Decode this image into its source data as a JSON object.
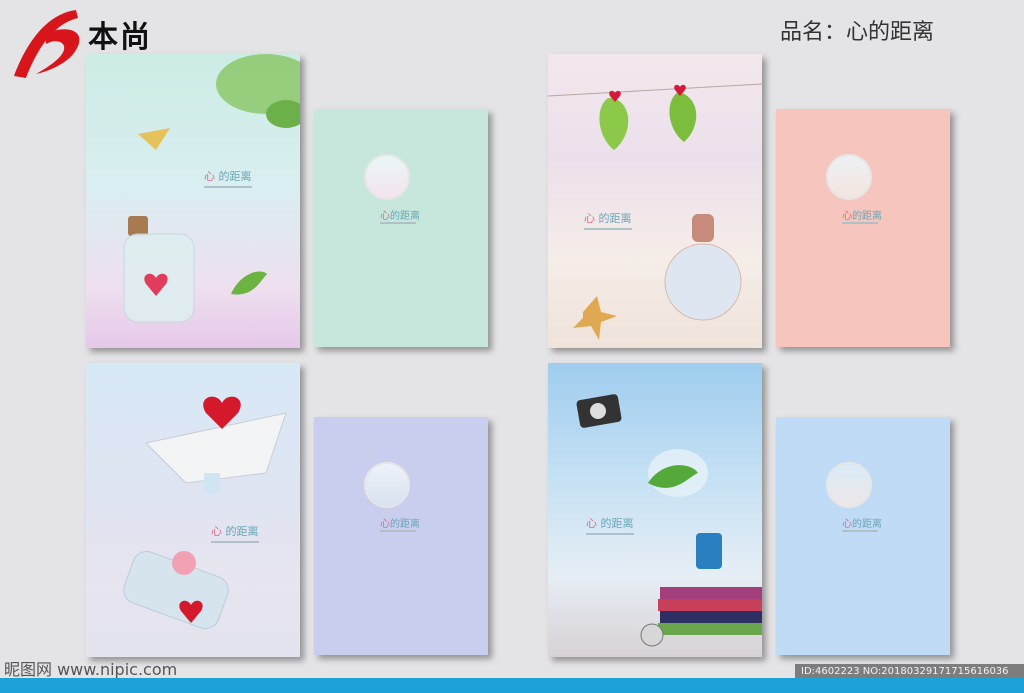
{
  "header": {
    "brand": "本尚",
    "product_label": "品名：心的距离"
  },
  "covers": [
    {
      "title_a": "心",
      "title_b": "的距离"
    },
    {
      "title_a": "心",
      "title_b": "的距离"
    },
    {
      "title_a": "心",
      "title_b": "的距离"
    },
    {
      "title_a": "心",
      "title_b": "的距离"
    }
  ],
  "backs": [
    {
      "title_a": "心",
      "title_b": "的距离",
      "color": "#c7e7dc"
    },
    {
      "title_a": "心",
      "title_b": "的距离",
      "color": "#f6c5bd"
    },
    {
      "title_a": "心",
      "title_b": "的距离",
      "color": "#c9cdee"
    },
    {
      "title_a": "心",
      "title_b": "的距离",
      "color": "#c0dbf5"
    }
  ],
  "watermark": {
    "site": "昵图网 www.nipic.com",
    "id": "ID:4602223 NO:20180329171715616036"
  }
}
